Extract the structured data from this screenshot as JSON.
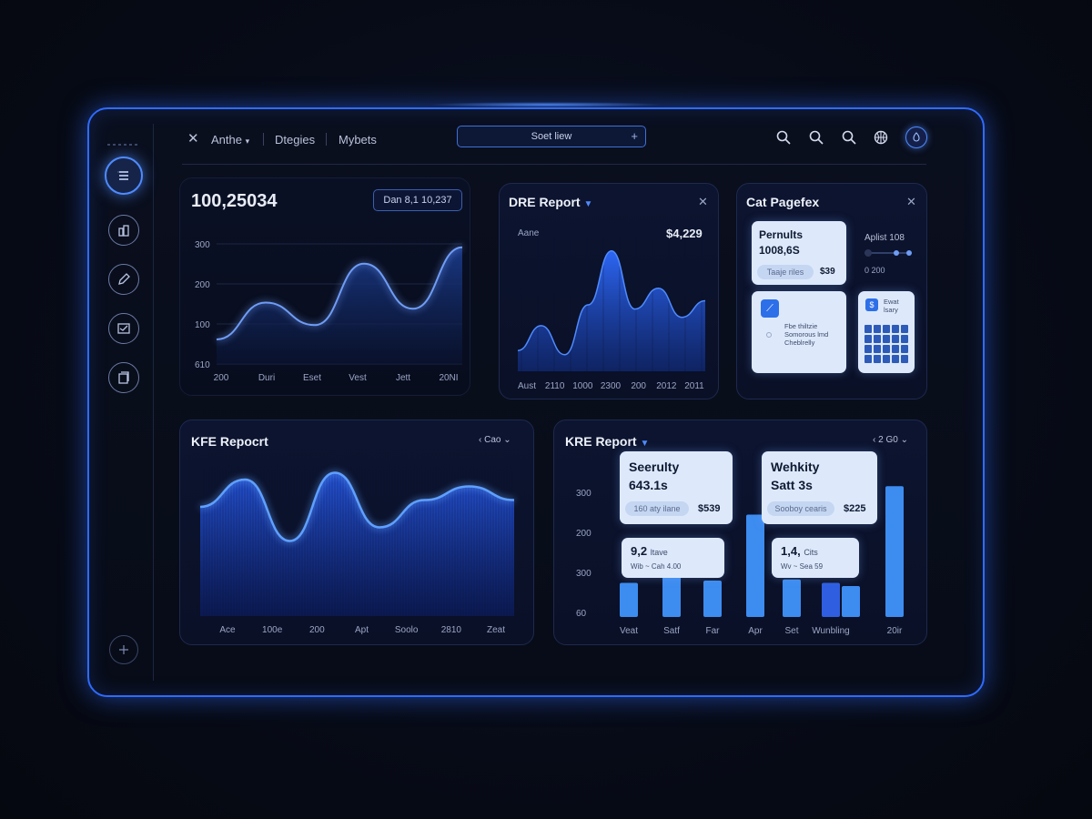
{
  "topbar": {
    "nav1": "Anthe",
    "nav2": "Dtegies",
    "nav3": "Mybets",
    "search_text": "Soet liew"
  },
  "card1": {
    "headline": "100,25034",
    "badge": "Dan 8,1 10,237"
  },
  "card2": {
    "title": "DRE Report",
    "sublabel": "Aane",
    "value": "$4,229"
  },
  "card3": {
    "title": "Cat Pagefex",
    "tile1_title": "Pernults",
    "tile1_value": "1008,6S",
    "tile1_pill": "Taaje riles",
    "tile1_amount": "$39",
    "slider_label": "Aplist 108",
    "slider_caption": "0 200",
    "tile2_text": "Fbe thiltzie Somorous lmd Cheblrelly",
    "tile3_text": "Ewat lsary"
  },
  "card4": {
    "title": "KFE Repocrt",
    "control": "Cao"
  },
  "card5": {
    "title": "KRE Report",
    "control": "2 G0",
    "overlay1": {
      "title": "Seerulty",
      "value": "643.1s",
      "pill": "160 aty ilane",
      "amount": "$539"
    },
    "overlay2": {
      "title": "Wehkity",
      "value": "Satt 3s",
      "pill": "Sooboy cearis",
      "amount": "$225"
    },
    "overlay3": {
      "title": "9,2",
      "subtitle": "ltave",
      "line": "Wib ~ Cah 4.00"
    },
    "overlay4": {
      "title": "1,4,",
      "subtitle": "Cits",
      "line": "Wv ~ Sea 59"
    }
  },
  "chart_data": [
    {
      "type": "area",
      "title": "",
      "x": [
        "200",
        "Duri",
        "Eset",
        "Vest",
        "Jett",
        "20NI"
      ],
      "yticks": [
        "300",
        "200",
        "100",
        "610"
      ],
      "series": [
        {
          "values": [
            60,
            150,
            95,
            245,
            135,
            285
          ]
        }
      ]
    },
    {
      "type": "area",
      "title": "DRE Report",
      "x": [
        "Aust",
        "2110",
        "1000",
        "2300",
        "200",
        "2012",
        "2011"
      ],
      "series": [
        {
          "values": [
            50,
            110,
            40,
            160,
            290,
            150,
            200,
            130,
            170
          ]
        }
      ]
    },
    {
      "type": "area",
      "title": "KFE Repocrt",
      "x": [
        "Ace",
        "100e",
        "200",
        "Apt",
        "Soolo",
        "2810",
        "Zeat"
      ],
      "series": [
        {
          "values": [
            160,
            200,
            110,
            210,
            130,
            170,
            190,
            170
          ]
        }
      ]
    },
    {
      "type": "bar",
      "title": "KRE Report",
      "categories": [
        "Veat",
        "Satf",
        "Far",
        "Apr",
        "Set",
        "Wunbling",
        "20ir"
      ],
      "yticks": [
        "300",
        "200",
        "300",
        "60"
      ],
      "series": [
        {
          "values": [
            30,
            38,
            32,
            90,
            33,
            30,
            115
          ]
        }
      ]
    }
  ],
  "colors": {
    "accent": "#2f6bff",
    "bg": "#080c18",
    "bar": "#3d8cf0"
  }
}
